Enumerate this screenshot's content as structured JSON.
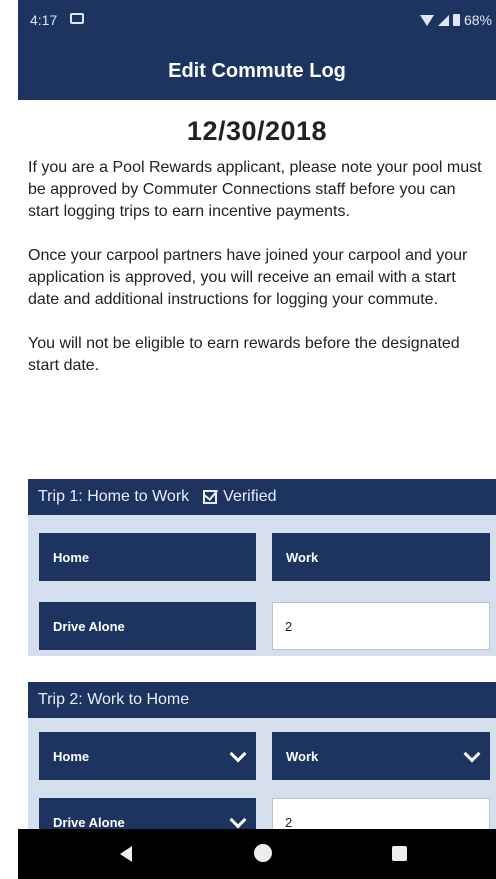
{
  "status_bar": {
    "time": "4:17",
    "battery": "68%"
  },
  "app_bar": {
    "title": "Edit Commute Log"
  },
  "content": {
    "date": "12/30/2018",
    "paragraphs": [
      "If you are a Pool Rewards applicant, please note your pool must be approved by Commuter Connections staff before you can start logging trips to earn incentive payments.",
      "Once your carpool partners have joined your carpool and your application is approved, you will receive an email with a start date and additional instructions for logging your commute.",
      "You will not be eligible to earn rewards before the designated start date."
    ]
  },
  "trips": [
    {
      "title": "Trip 1: Home to Work",
      "verified_label": "Verified",
      "from": "Home",
      "to": "Work",
      "mode": "Drive Alone",
      "count": "2"
    },
    {
      "title": "Trip 2: Work to Home",
      "from": "Home",
      "to": "Work",
      "mode": "Drive Alone",
      "count": "2"
    }
  ]
}
